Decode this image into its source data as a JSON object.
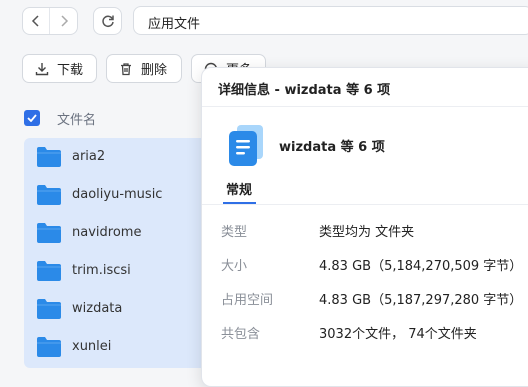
{
  "address": {
    "path": "应用文件"
  },
  "toolbar": {
    "download_label": "下载",
    "delete_label": "删除",
    "more_label": "更多"
  },
  "file_list": {
    "header_label": "文件名",
    "items": [
      {
        "name": "aria2"
      },
      {
        "name": "daoliyu-music"
      },
      {
        "name": "navidrome"
      },
      {
        "name": "trim.iscsi"
      },
      {
        "name": "wizdata"
      },
      {
        "name": "xunlei"
      }
    ]
  },
  "details": {
    "title": "详细信息 - wizdata 等 6 项",
    "subject": "wizdata 等 6 项",
    "tab": "常规",
    "props": [
      {
        "key": "类型",
        "value": "类型均为 文件夹"
      },
      {
        "key": "大小",
        "value": "4.83 GB（5,184,270,509 字节）"
      },
      {
        "key": "占用空间",
        "value": "4.83 GB（5,187,297,280 字节）"
      },
      {
        "key": "共包含",
        "value": "3032个文件， 74个文件夹"
      }
    ]
  },
  "colors": {
    "accent": "#2f6fe6",
    "selection": "#dce8fb",
    "folder": "#2b8ae8"
  }
}
